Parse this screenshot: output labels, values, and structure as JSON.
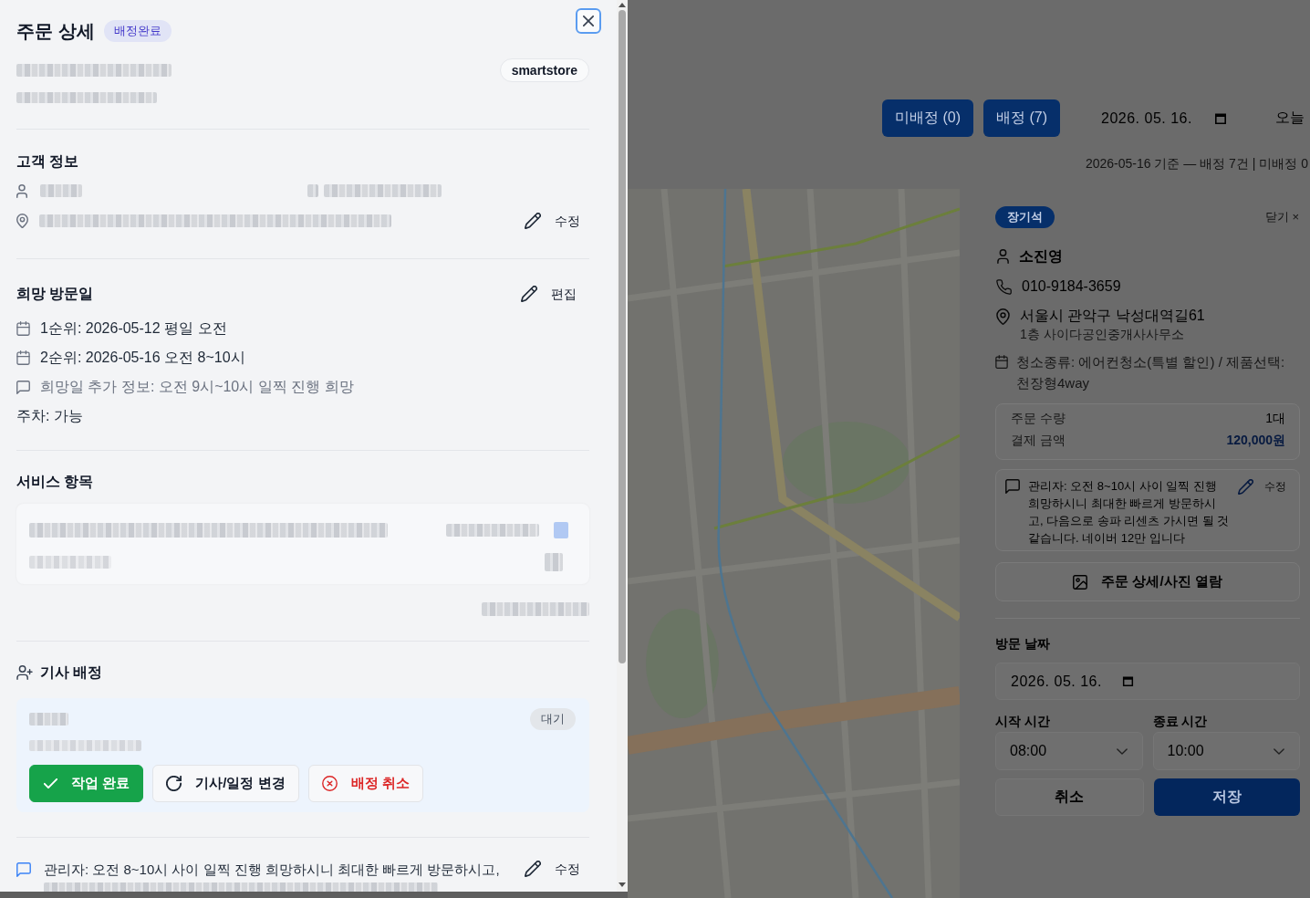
{
  "drawer": {
    "title": "주문 상세",
    "status_badge": "배정완료",
    "channel": "smartstore",
    "customer": {
      "heading": "고객 정보",
      "edit_label": "수정"
    },
    "preferred_visit": {
      "heading": "희망 방문일",
      "edit_label": "편집",
      "lines": [
        {
          "kind": "date",
          "text": "1순위: 2026-05-12 평일 오전"
        },
        {
          "kind": "date",
          "text": "2순위: 2026-05-16 오전 8~10시"
        },
        {
          "kind": "note",
          "text": "희망일 추가 정보: 오전 9시~10시 일찍 진행 희망"
        },
        {
          "kind": "plain",
          "text": "주차: 가능"
        }
      ]
    },
    "services": {
      "heading": "서비스 항목"
    },
    "assignment": {
      "heading": "기사 배정",
      "status": "대기",
      "actions": [
        {
          "kind": "complete",
          "label": "작업 완료"
        },
        {
          "kind": "change",
          "label": "기사/일정 변경"
        },
        {
          "kind": "cancel",
          "label": "배정 취소"
        }
      ]
    },
    "memo": {
      "text": "관리자: 오전 8~10시 사이 일찍 진행 희망하시니 최대한 빠르게 방문하시고,",
      "edit_label": "수정"
    }
  },
  "board": {
    "filters": [
      {
        "label": "미배정 (0)"
      },
      {
        "label": "배정 (7)"
      }
    ],
    "date": "2026. 05. 16.",
    "today_button": "오늘",
    "summary": "2026-05-16 기준 — 배정 7건 | 미배정 0",
    "detail": {
      "driver": "장기석",
      "close_label": "닫기 ×",
      "customer_name": "소진영",
      "phone": "010-9184-3659",
      "address": "서울시 관악구 낙성대역길61",
      "address_detail": "1층 사이다공인중개사사무소",
      "service": "청소종류: 에어컨청소(특별 할인) / 제품선택: 천장형4way",
      "summary_rows": [
        {
          "kind": "count",
          "label": "주문 수량",
          "value": "1대"
        },
        {
          "kind": "price",
          "label": "결제 금액",
          "value": "120,000원"
        }
      ],
      "memo": "관리자: 오전 8~10시 사이 일찍 진행 희망하시니 최대한 빠르게 방문하시고, 다음으로 송파 리센츠 가시면 될 것 같습니다. 네이버 12만 입니다",
      "memo_edit_label": "수정",
      "photos_button": "주문 상세/사진 열람",
      "visit_date_label": "방문 날짜",
      "visit_date": "2026. 05. 16.",
      "start_label": "시작 시간",
      "start_time": "08:00",
      "end_label": "종료 시간",
      "end_time": "10:00",
      "cancel_button": "취소",
      "save_button": "저장"
    }
  }
}
